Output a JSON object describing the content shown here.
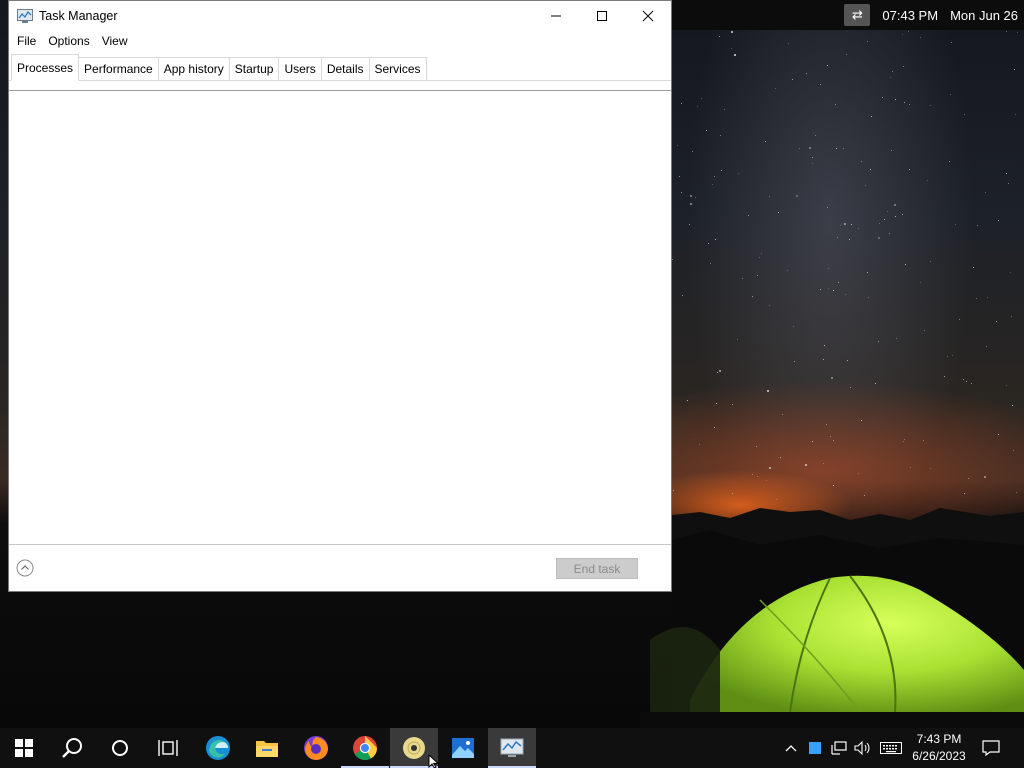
{
  "topbar": {
    "swap_icon": "swap-arrows-icon",
    "time": "07:43 PM",
    "date": "Mon Jun 26"
  },
  "window": {
    "title": "Task Manager",
    "controls": [
      "minimize",
      "maximize",
      "close"
    ],
    "menu": [
      "File",
      "Options",
      "View"
    ],
    "tabs": [
      "Processes",
      "Performance",
      "App history",
      "Startup",
      "Users",
      "Details",
      "Services"
    ],
    "active_tab": "Processes",
    "end_task_label": "End task"
  },
  "taskbar": {
    "items": [
      "start",
      "search",
      "cortana",
      "task-view",
      "edge",
      "file-explorer",
      "firefox",
      "chrome",
      "media-player",
      "photos",
      "task-manager"
    ],
    "clock_time": "7:43 PM",
    "clock_date": "6/26/2023"
  },
  "colors": {
    "taskbar_bg": "#101010",
    "active_item_bg": "#3a3a3a",
    "end_task_bg": "#cccccc"
  }
}
